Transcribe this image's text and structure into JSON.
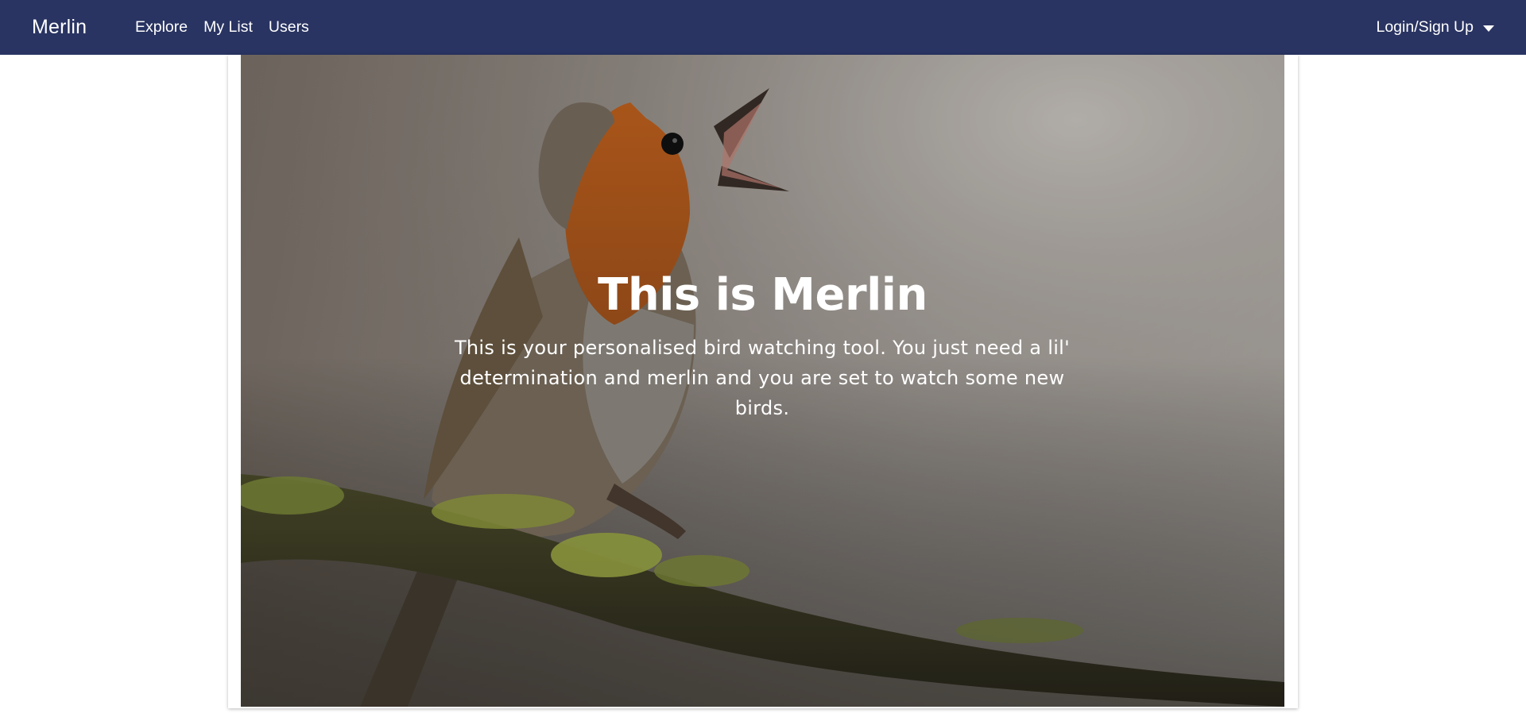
{
  "navbar": {
    "brand": "Merlin",
    "links": [
      {
        "label": "Explore"
      },
      {
        "label": "My List"
      },
      {
        "label": "Users"
      }
    ],
    "account_menu_label": "Login/Sign Up",
    "background_color": "#293462"
  },
  "hero": {
    "title": "This is Merlin",
    "subtitle": "This is your personalised bird watching tool. You just need a lil' determination and merlin and you are set to watch some new birds."
  }
}
